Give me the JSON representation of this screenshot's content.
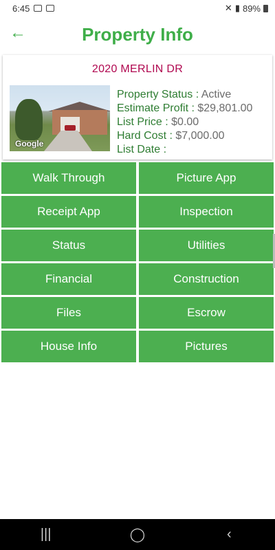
{
  "status_bar": {
    "time": "6:45",
    "battery": "89%"
  },
  "header": {
    "back_icon": "arrow-left-icon",
    "title": "Property Info"
  },
  "property": {
    "address": "2020 MERLIN DR",
    "photo_credit": "Google",
    "details": [
      {
        "label": "Property Status : ",
        "value": "Active"
      },
      {
        "label": "Estimate Profit : ",
        "value": "$29,801.00"
      },
      {
        "label": "List Price : ",
        "value": "$0.00"
      },
      {
        "label": "Hard Cost : ",
        "value": "$7,000.00"
      },
      {
        "label": "List Date : ",
        "value": ""
      }
    ]
  },
  "actions": [
    "Walk Through",
    "Picture App",
    "Receipt App",
    "Inspection",
    "Status",
    "Utilities",
    "Financial",
    "Construction",
    "Files",
    "Escrow",
    "House Info",
    "Pictures"
  ],
  "nav": {
    "recents_icon": "recents-icon",
    "home_icon": "home-icon",
    "back_icon": "back-icon"
  },
  "colors": {
    "accent": "#3fae49",
    "button": "#4caf50",
    "address": "#b0064f"
  }
}
